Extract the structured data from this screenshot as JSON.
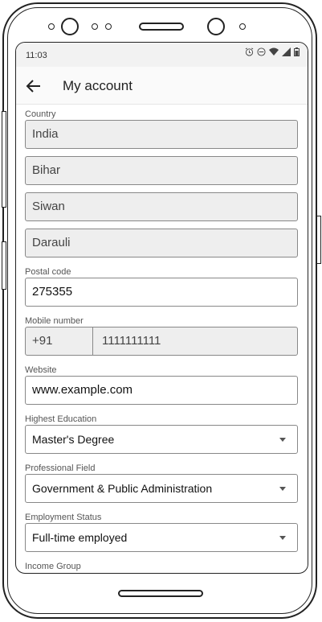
{
  "status_bar": {
    "time": "11:03"
  },
  "app_bar": {
    "title": "My account"
  },
  "form": {
    "country_label": "Country",
    "country_value": "India",
    "state_value": "Bihar",
    "district_value": "Siwan",
    "block_value": "Darauli",
    "postal_label": "Postal code",
    "postal_value": "275355",
    "mobile_label": "Mobile number",
    "mobile_code": "+91",
    "mobile_number": "1111111111",
    "website_label": "Website",
    "website_value": "www.example.com",
    "education_label": "Highest Education",
    "education_value": "Master's Degree",
    "professional_label": "Professional Field",
    "professional_value": "Government & Public Administration",
    "employment_label": "Employment Status",
    "employment_value": "Full-time employed",
    "income_label": "Income Group"
  }
}
